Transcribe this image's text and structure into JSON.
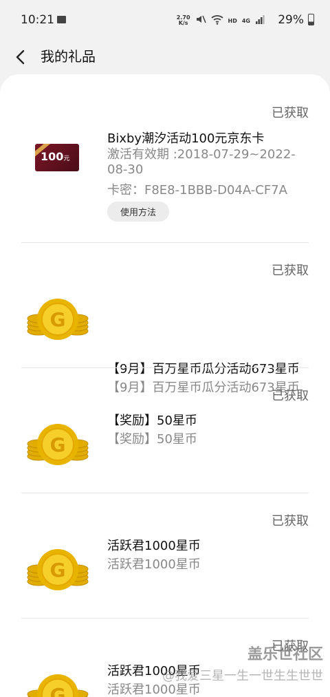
{
  "status_bar": {
    "time": "10:21",
    "net_speed_value": "2.70",
    "net_speed_unit": "K/s",
    "hd_label": "HD",
    "network_label": "4G",
    "battery_percent": "29%"
  },
  "header": {
    "title": "我的礼品"
  },
  "gifts": [
    {
      "status": "已获取",
      "title": "Bixby潮汐活动100元京东卡",
      "validity": "激活有效期 :2018-07-29~2022-08-30",
      "card_secret": "卡密：F8E8-1BBB-D04A-CF7A",
      "how_to_use": "使用方法",
      "image_amount": "100",
      "image_unit": "元",
      "icon": "jd-gift-card-icon"
    },
    {
      "status": "已获取",
      "title": "【9月】百万星币瓜分活动673星币",
      "subtitle": "【9月】百万星币瓜分活动673星币",
      "icon": "gold-coin-icon"
    },
    {
      "status": "已获取",
      "title": "【奖励】50星币",
      "subtitle": "【奖励】50星币",
      "icon": "gold-coin-icon"
    },
    {
      "status": "已获取",
      "title": "活跃君1000星币",
      "subtitle": "活跃君1000星币",
      "icon": "gold-coin-icon"
    },
    {
      "status": "已获取",
      "title": "活跃君1000星币",
      "subtitle": "活跃君1000星币",
      "icon": "gold-coin-icon"
    }
  ],
  "watermark": {
    "brand": "盖乐世社区",
    "user": "@我爱三星一生一世生生世世"
  },
  "colors": {
    "background": "#f2f2f2",
    "card": "#ffffff",
    "coin_gold": "#f2c200",
    "status_text": "#666666"
  }
}
